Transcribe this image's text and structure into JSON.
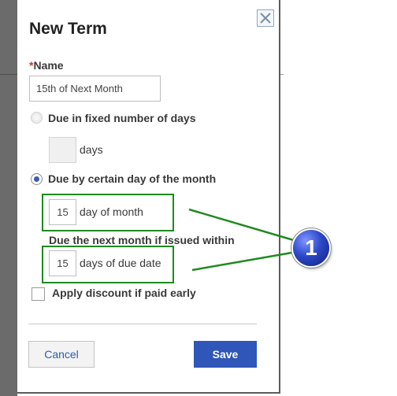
{
  "dialog": {
    "title": "New Term",
    "name_label": "Name",
    "required_mark": "*",
    "name_value": "15th of Next Month",
    "option_fixed_days": "Due in fixed number of days",
    "fixed_days_unit": "days",
    "fixed_days_value": "",
    "option_day_of_month": "Due by certain day of the month",
    "day_of_month_value": "15",
    "day_of_month_unit": "day of month",
    "next_month_label": "Due the next month if issued within",
    "days_due_value": "15",
    "days_due_unit": "days of due date",
    "discount_label": "Apply discount if paid early",
    "cancel_label": "Cancel",
    "save_label": "Save",
    "selected_option": "due_by_day_of_month",
    "discount_checked": false
  },
  "callout": {
    "number": "1"
  },
  "colors": {
    "accent": "#2f56b8",
    "highlight": "#1f8a1f",
    "required": "#d4351c",
    "callout": "#2d48c8"
  },
  "icons": {
    "close": "close-icon"
  }
}
